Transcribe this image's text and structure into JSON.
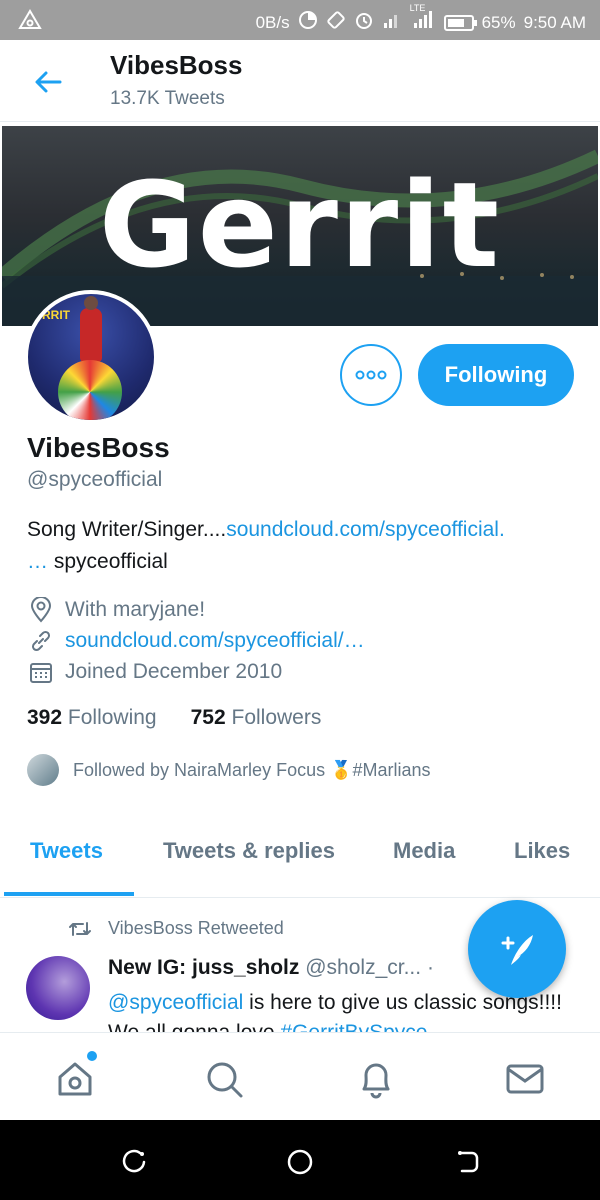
{
  "status_bar": {
    "speed": "0B/s",
    "lte": "LTE",
    "battery": "65%",
    "time": "9:50 AM"
  },
  "header": {
    "title": "VibesBoss",
    "subtitle": "13.7K Tweets"
  },
  "banner": {
    "text": "Gerrit"
  },
  "avatar": {
    "tag": "RRIT"
  },
  "profile": {
    "follow_label": "Following",
    "display_name": "VibesBoss",
    "handle": "@spyceofficial",
    "bio_text": "Song Writer/Singer....",
    "bio_link": "soundcloud.com/spyceofficial.",
    "bio_ellipsis": "…",
    "bio_tail": " spyceofficial",
    "location": "With maryjane!",
    "website": "soundcloud.com/spyceofficial/…",
    "joined": "Joined December 2010",
    "following_count": "392",
    "following_label": "Following",
    "followers_count": "752",
    "followers_label": "Followers",
    "followed_by": "Followed by NairaMarley Focus 🥇#Marlians"
  },
  "tabs": [
    {
      "label": "Tweets",
      "active": true
    },
    {
      "label": "Tweets & replies"
    },
    {
      "label": "Media"
    },
    {
      "label": "Likes"
    }
  ],
  "tweet": {
    "retweet_label": "VibesBoss Retweeted",
    "author_name": "New IG: juss_sholz",
    "author_handle": "@sholz_cr...",
    "separator": "·",
    "mention": "@spyceofficial",
    "body": " is here to give us classic songs!!!! We all gonna love ",
    "hashtag": "#GerritBySpyce"
  },
  "colors": {
    "accent": "#1da1f2",
    "text": "#14171a",
    "secondary": "#657786"
  }
}
